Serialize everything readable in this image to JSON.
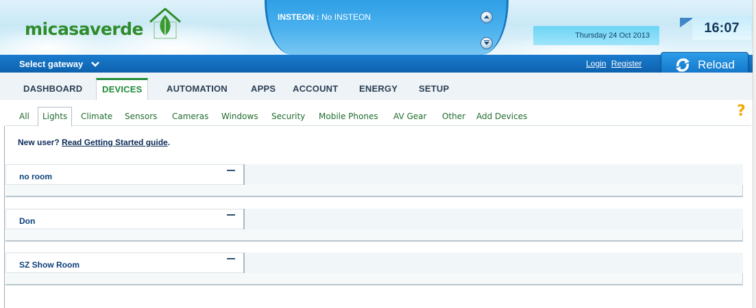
{
  "brand": {
    "logo_text": "micasaverde"
  },
  "insteon": {
    "prefix": "INSTEON :",
    "status": "No INSTEON"
  },
  "datetime": {
    "date": "Thursday 24 Oct 2013",
    "time": "16:07"
  },
  "gateway": {
    "label": "Select gateway"
  },
  "auth": {
    "login": "Login",
    "register": "Register"
  },
  "reload": {
    "label": "Reload"
  },
  "main_tabs": [
    {
      "label": "DASHBOARD"
    },
    {
      "label": "DEVICES"
    },
    {
      "label": "AUTOMATION"
    },
    {
      "label": "APPS"
    },
    {
      "label": "ACCOUNT"
    },
    {
      "label": "ENERGY"
    },
    {
      "label": "SETUP"
    }
  ],
  "main_tabs_active": "DEVICES",
  "sub_tabs": [
    {
      "label": "All"
    },
    {
      "label": "Lights"
    },
    {
      "label": "Climate"
    },
    {
      "label": "Sensors"
    },
    {
      "label": "Cameras"
    },
    {
      "label": "Windows"
    },
    {
      "label": "Security"
    },
    {
      "label": "Mobile Phones"
    },
    {
      "label": "AV Gear"
    },
    {
      "label": "Other"
    },
    {
      "label": "Add Devices"
    }
  ],
  "sub_tabs_active": "Lights",
  "help": {
    "symbol": "?"
  },
  "intro": {
    "prefix": "New user?",
    "link": "Read Getting Started guide",
    "suffix": "."
  },
  "rooms": [
    {
      "name": "no room"
    },
    {
      "name": "Don"
    },
    {
      "name": "SZ Show Room"
    }
  ],
  "colors": {
    "brand_green": "#2e8c2a",
    "nav_blue": "#0d62ae",
    "help_yellow": "#f2a900",
    "room_name": "#0c3f7a"
  }
}
